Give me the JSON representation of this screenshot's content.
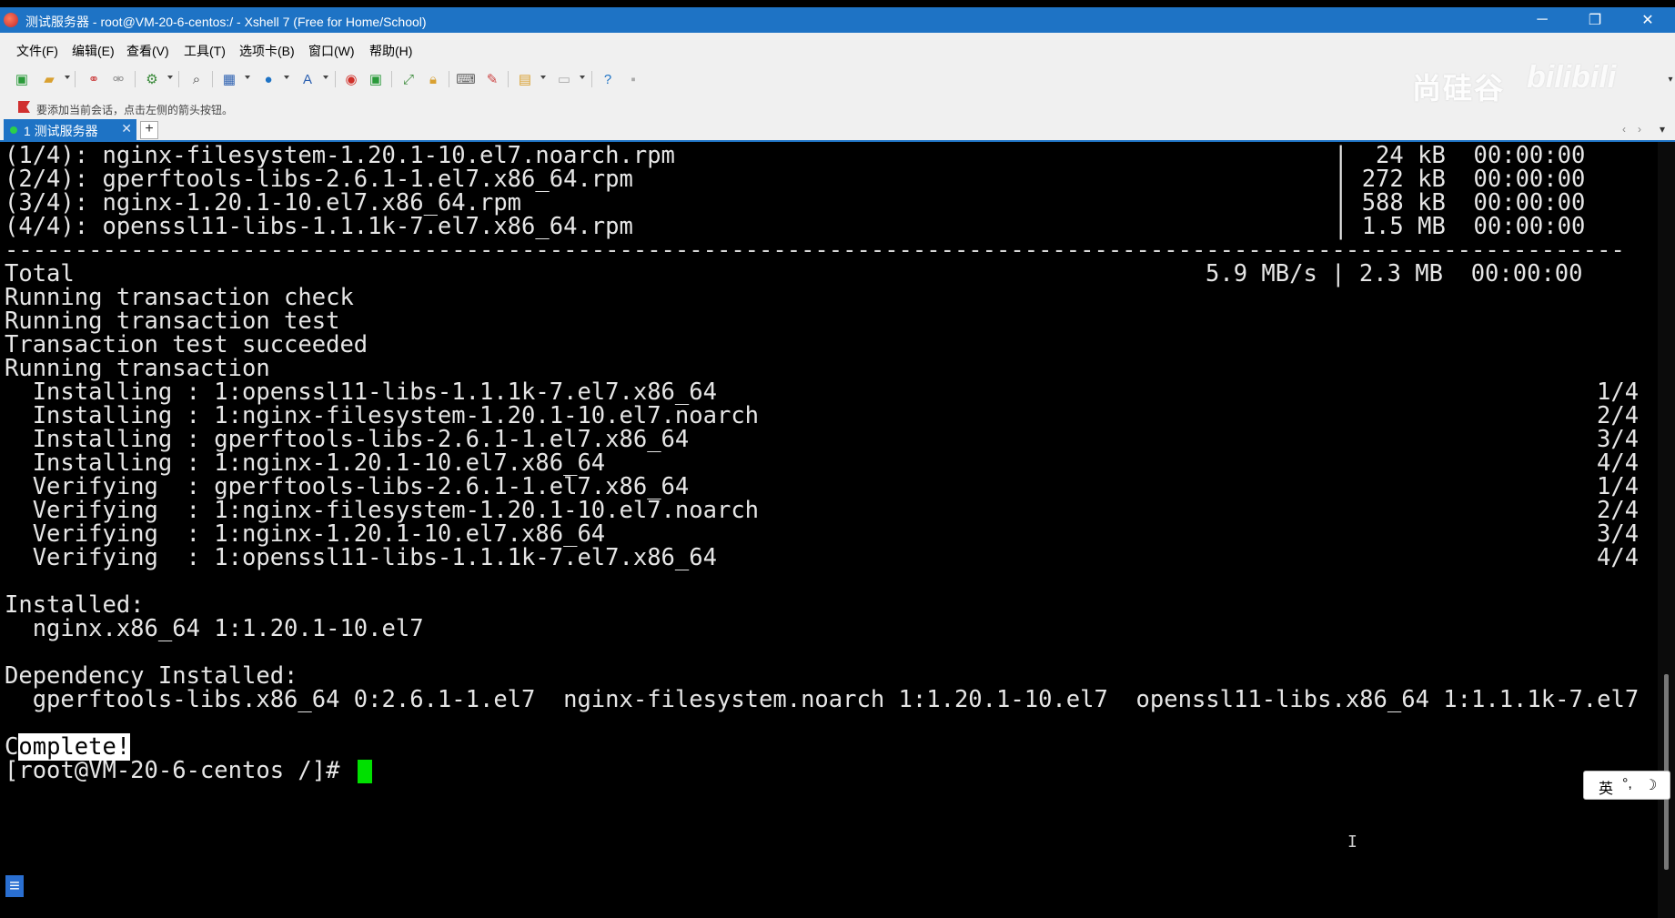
{
  "window": {
    "title": "测试服务器 - root@VM-20-6-centos:/ - Xshell 7 (Free for Home/School)",
    "controls": {
      "minimize": "─",
      "maximize": "❐",
      "close": "✕"
    }
  },
  "menu": [
    "文件(F)",
    "编辑(E)",
    "查看(V)",
    "工具(T)",
    "选项卡(B)",
    "窗口(W)",
    "帮助(H)"
  ],
  "watermark": {
    "text": "尚硅谷",
    "logo": "bilibili"
  },
  "hint": "要添加当前会话，点击左侧的箭头按钮。",
  "tabs": [
    {
      "label": "1 测试服务器",
      "close": "✕"
    }
  ],
  "new_tab": "+",
  "tab_nav": {
    "left": "‹",
    "right": "›",
    "menu": "▾"
  },
  "terminal": {
    "downloads": [
      {
        "left": "(1/4): nginx-filesystem-1.20.1-10.el7.noarch.rpm",
        "right": "|  24 kB  00:00:00"
      },
      {
        "left": "(2/4): gperftools-libs-2.6.1-1.el7.x86_64.rpm",
        "right": "| 272 kB  00:00:00"
      },
      {
        "left": "(3/4): nginx-1.20.1-10.el7.x86_64.rpm",
        "right": "| 588 kB  00:00:00"
      },
      {
        "left": "(4/4): openssl11-libs-1.1.1k-7.el7.x86_64.rpm",
        "right": "| 1.5 MB  00:00:00"
      }
    ],
    "separator": "--------------------------------------------------------------------------------------------------------------------",
    "total": {
      "left": "Total",
      "right": "5.9 MB/s | 2.3 MB  00:00:00"
    },
    "status_lines": [
      "Running transaction check",
      "Running transaction test",
      "Transaction test succeeded",
      "Running transaction"
    ],
    "steps": [
      {
        "text": "  Installing : 1:openssl11-libs-1.1.1k-7.el7.x86_64",
        "count": "1/4"
      },
      {
        "text": "  Installing : 1:nginx-filesystem-1.20.1-10.el7.noarch",
        "count": "2/4"
      },
      {
        "text": "  Installing : gperftools-libs-2.6.1-1.el7.x86_64",
        "count": "3/4"
      },
      {
        "text": "  Installing : 1:nginx-1.20.1-10.el7.x86_64",
        "count": "4/4"
      },
      {
        "text": "  Verifying  : gperftools-libs-2.6.1-1.el7.x86_64",
        "count": "1/4"
      },
      {
        "text": "  Verifying  : 1:nginx-filesystem-1.20.1-10.el7.noarch",
        "count": "2/4"
      },
      {
        "text": "  Verifying  : 1:nginx-1.20.1-10.el7.x86_64",
        "count": "3/4"
      },
      {
        "text": "  Verifying  : 1:openssl11-libs-1.1.1k-7.el7.x86_64",
        "count": "4/4"
      }
    ],
    "installed_header": "Installed:",
    "installed_pkg": "  nginx.x86_64 1:1.20.1-10.el7",
    "dependency_header": "Dependency Installed:",
    "dependency_pkgs": "  gperftools-libs.x86_64 0:2.6.1-1.el7  nginx-filesystem.noarch 1:1.20.1-10.el7  openssl11-libs.x86_64 1:1.1.1k-7.el7",
    "complete": {
      "first": "C",
      "rest": "omplete!"
    },
    "prompt": "[root@VM-20-6-centos /]# "
  },
  "ime": {
    "lang": "英",
    "punct": "°,",
    "moon": "☽"
  },
  "colors": {
    "titlebar": "#1e73c5",
    "tab_active": "#1e73c5",
    "cursor": "#00e000",
    "terminal_bg": "#000000"
  }
}
